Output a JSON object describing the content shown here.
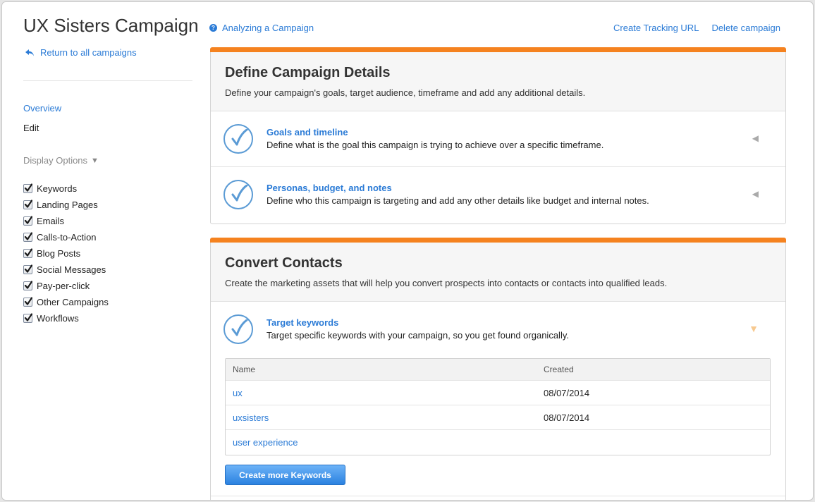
{
  "sidebar": {
    "title": "UX Sisters Campaign",
    "return_label": "Return to all campaigns",
    "nav": {
      "overview": "Overview",
      "edit": "Edit"
    },
    "display_options_label": "Display Options",
    "options": [
      {
        "label": "Keywords",
        "checked": true
      },
      {
        "label": "Landing Pages",
        "checked": true
      },
      {
        "label": "Emails",
        "checked": true
      },
      {
        "label": "Calls-to-Action",
        "checked": true
      },
      {
        "label": "Blog Posts",
        "checked": true
      },
      {
        "label": "Social Messages",
        "checked": true
      },
      {
        "label": "Pay-per-click",
        "checked": true
      },
      {
        "label": "Other Campaigns",
        "checked": true
      },
      {
        "label": "Workflows",
        "checked": true
      }
    ]
  },
  "header": {
    "analyze_label": "Analyzing a Campaign",
    "links": {
      "tracking": "Create Tracking URL",
      "delete": "Delete campaign"
    }
  },
  "panels": {
    "define": {
      "title": "Define Campaign Details",
      "subtitle": "Define your campaign's goals, target audience, timeframe and add any additional details.",
      "tasks": [
        {
          "title": "Goals and timeline",
          "desc": "Define what is the goal this campaign is trying to achieve over a specific timeframe.",
          "completed": true
        },
        {
          "title": "Personas, budget, and notes",
          "desc": "Define who this campaign is targeting and add any other details like budget and internal notes.",
          "completed": true
        }
      ]
    },
    "convert": {
      "title": "Convert Contacts",
      "subtitle": "Create the marketing assets that will help you convert prospects into contacts or contacts into qualified leads.",
      "tasks": [
        {
          "title": "Target keywords",
          "desc": "Target specific keywords with your campaign, so you get found organically.",
          "completed": true
        }
      ],
      "table": {
        "columns": [
          "Name",
          "Created"
        ],
        "rows": [
          {
            "name": "ux",
            "created": "08/07/2014"
          },
          {
            "name": "uxsisters",
            "created": "08/07/2014"
          },
          {
            "name": "user experience",
            "created": ""
          }
        ]
      },
      "create_button": "Create more Keywords"
    }
  },
  "colors": {
    "accent": "#f5821f",
    "link": "#2b7bd6",
    "check": "#5b9bd5"
  }
}
